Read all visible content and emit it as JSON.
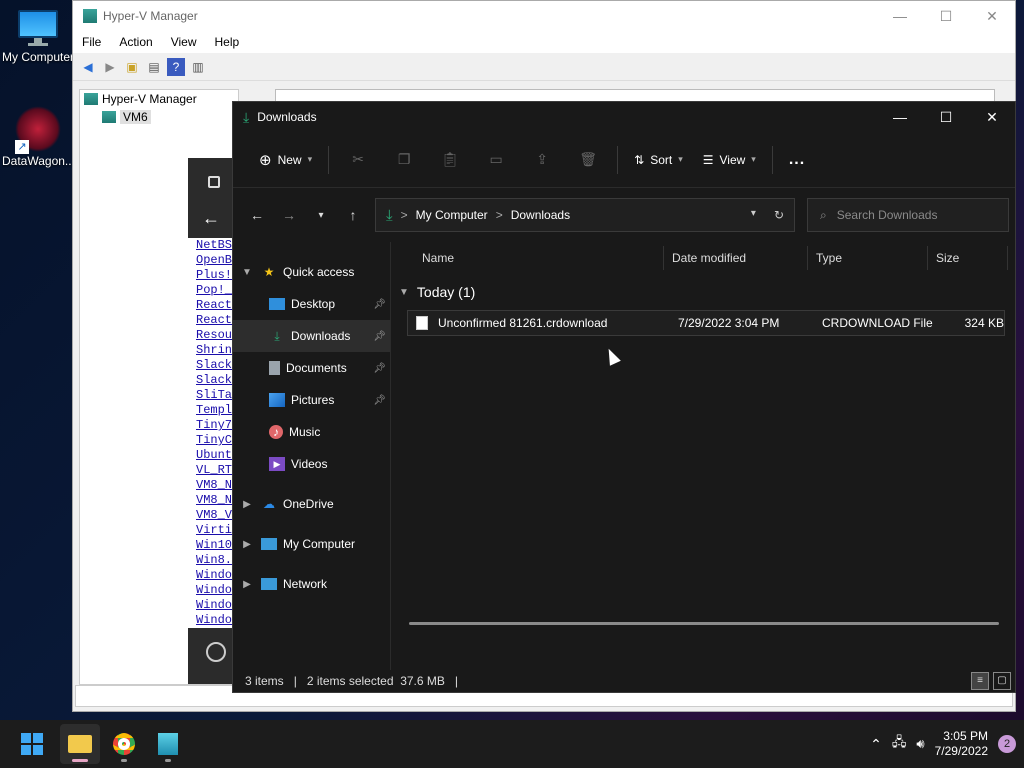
{
  "desktop": {
    "icons": [
      {
        "label": "My Computer"
      },
      {
        "label": "DataWagon..."
      }
    ]
  },
  "hyperv": {
    "title": "Hyper-V Manager",
    "menu": [
      "File",
      "Action",
      "View",
      "Help"
    ],
    "tree": {
      "root": "Hyper-V Manager",
      "child": "VM6"
    }
  },
  "middle_panel": {
    "links": [
      "NetBS",
      "OpenB",
      "Plus!",
      "Pop!_",
      "React",
      "React",
      "Resou",
      "Shrin",
      "Slack",
      "Slack",
      "SliTa",
      "Templ",
      "Tiny7",
      "TinyC",
      "Ubunt",
      "VL_RT",
      "VM8_N",
      "VM8_N",
      "VM8_V",
      "Virti",
      "Win10",
      "Win8.",
      "Windo",
      "Windo",
      "Windo",
      "Windo"
    ]
  },
  "explorer": {
    "title": "Downloads",
    "commands": {
      "new": "New",
      "sort": "Sort",
      "view": "View",
      "more": "..."
    },
    "address": {
      "root": "My Computer",
      "current": "Downloads",
      "sep": ">"
    },
    "search": {
      "placeholder": "Search Downloads"
    },
    "nav": {
      "quick_access": "Quick access",
      "items": [
        "Desktop",
        "Downloads",
        "Documents",
        "Pictures",
        "Music",
        "Videos"
      ],
      "onedrive": "OneDrive",
      "my_computer": "My Computer",
      "network": "Network"
    },
    "columns": {
      "name": "Name",
      "date": "Date modified",
      "type": "Type",
      "size": "Size"
    },
    "group": "Today (1)",
    "files": [
      {
        "name": "Unconfirmed 81261.crdownload",
        "date": "7/29/2022 3:04 PM",
        "type": "CRDOWNLOAD File",
        "size": "324 KB"
      }
    ],
    "status": {
      "items": "3 items",
      "sep": "|",
      "selected": "2 items selected  37.6 MB"
    }
  },
  "taskbar": {
    "time": "3:05 PM",
    "date": "7/29/2022",
    "notifications": "2"
  },
  "colors": {
    "accent_green": "#2aa876",
    "folder_yellow": "#f2c94c",
    "star": "#f5c518"
  }
}
